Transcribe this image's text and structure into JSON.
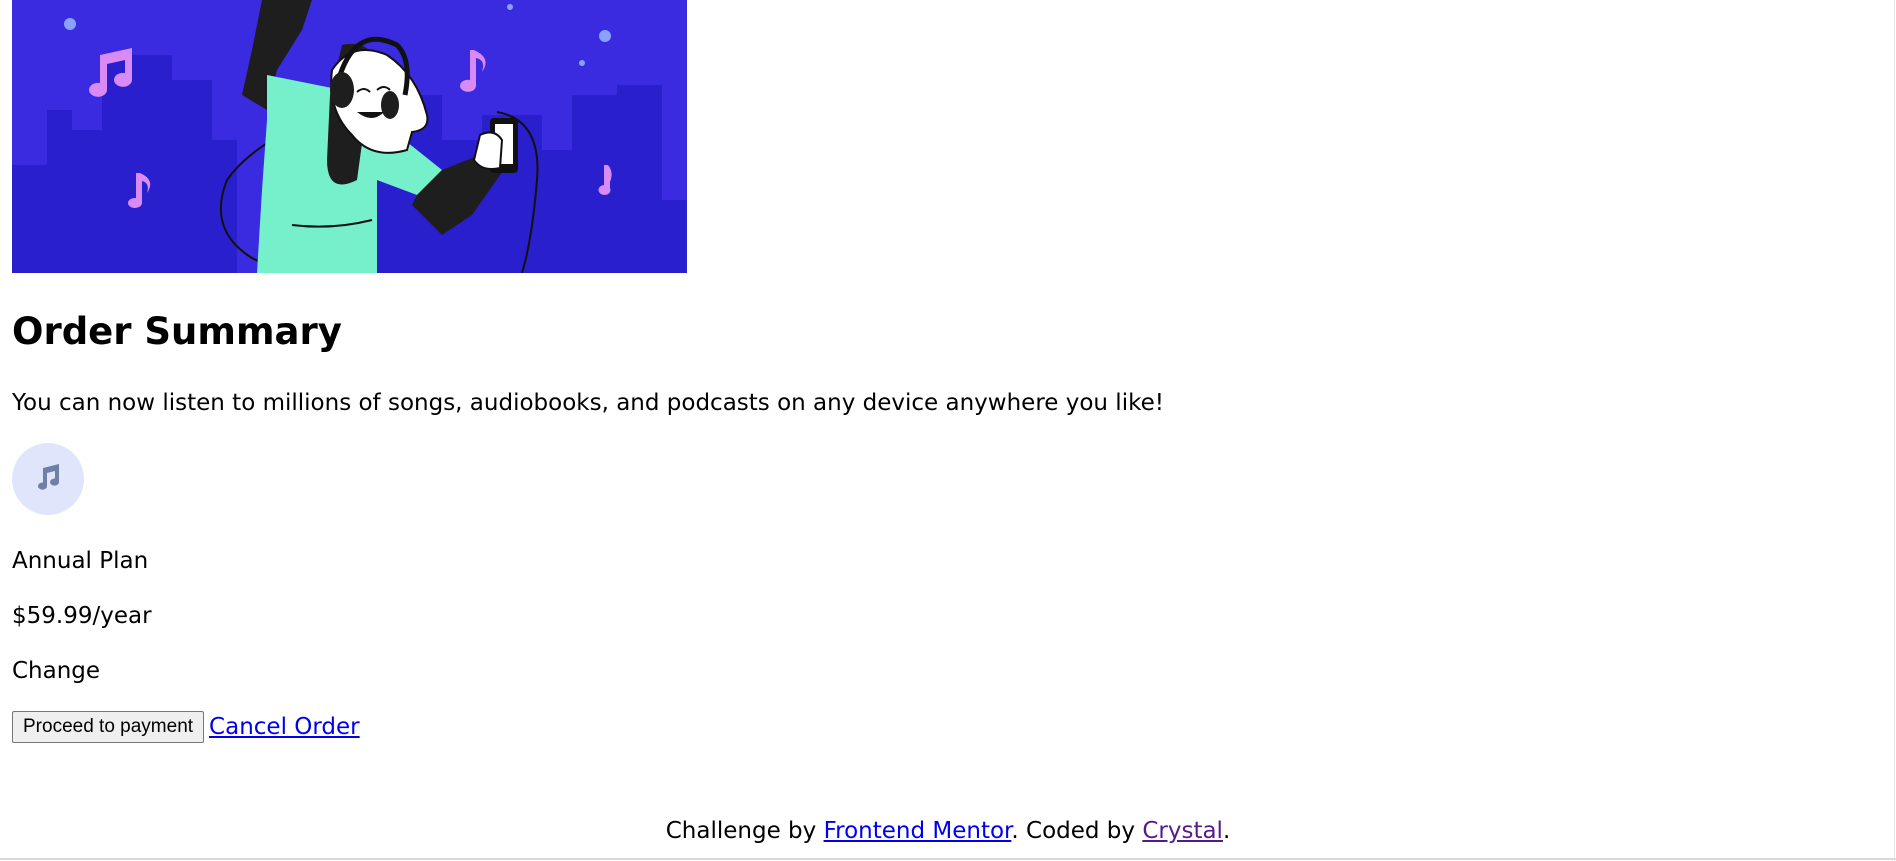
{
  "hero": {
    "illustration": "hero-illustration",
    "colors": {
      "background": "#3a2be0",
      "buildings": "#2a1fcc",
      "shirt": "#76efcb",
      "notes": "#d98af5",
      "dots": "#8aa2ff"
    }
  },
  "summary": {
    "title": "Order Summary",
    "description": "You can now listen to millions of songs, audiobooks, and podcasts on any device anywhere you like!",
    "music_icon": "music-note-icon",
    "icon_bg": "#dfe6fb",
    "icon_color": "#717fa6"
  },
  "plan": {
    "name": "Annual Plan",
    "price": "$59.99/year",
    "change_label": "Change"
  },
  "actions": {
    "proceed_label": "Proceed to payment",
    "cancel_label": "Cancel Order"
  },
  "footer": {
    "prefix": "Challenge by ",
    "mentor_link": "Frontend Mentor",
    "middle": ". Coded by ",
    "author_link": "Crystal",
    "suffix": "."
  }
}
